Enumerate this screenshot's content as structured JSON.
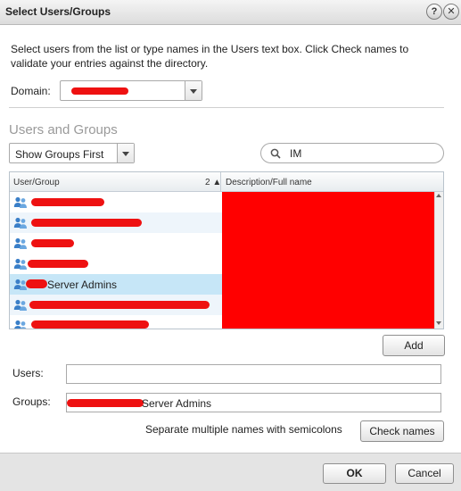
{
  "dialog": {
    "title": "Select Users/Groups",
    "help_glyph": "?",
    "close_glyph": "✕"
  },
  "instructions": "Select users from the list or type names in the Users text box. Click Check names to validate your entries against the directory.",
  "domain": {
    "label": "Domain:"
  },
  "section_title": "Users and Groups",
  "filter": {
    "selected": "Show Groups First"
  },
  "search": {
    "value": "IM"
  },
  "grid": {
    "columns": [
      "User/Group",
      "Description/Full name"
    ],
    "sort_indicator": "2 ▲",
    "rows": [
      {
        "name": ""
      },
      {
        "name": ""
      },
      {
        "name": ""
      },
      {
        "name": ""
      },
      {
        "name": "Server Admins"
      },
      {
        "name": ""
      },
      {
        "name": ""
      }
    ]
  },
  "buttons": {
    "add": "Add",
    "check_names": "Check names",
    "ok": "OK",
    "cancel": "Cancel"
  },
  "users_field": {
    "label": "Users:",
    "value": ""
  },
  "groups_field": {
    "label": "Groups:",
    "value": "Server Admins"
  },
  "hint": "Separate multiple names with semicolons",
  "icons": {
    "group": "group-icon",
    "search": "search-icon",
    "dropdown": "chevron-down-icon"
  },
  "colors": {
    "selection": "#c6e6f7",
    "alt_row": "#eef5fb",
    "redaction": "#ff0000",
    "group_icon": "#3a7fc8"
  }
}
